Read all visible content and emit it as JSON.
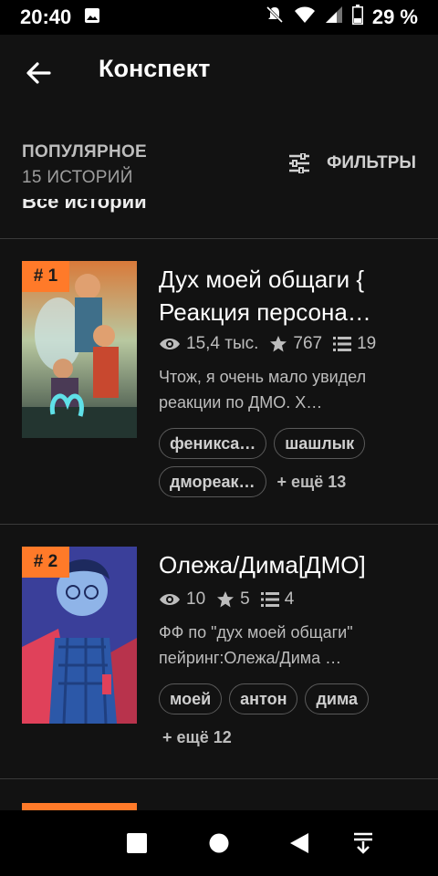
{
  "status": {
    "time": "20:40",
    "battery": "29 %"
  },
  "header": {
    "title": "Конспект"
  },
  "subheader": {
    "title": "ПОПУЛЯРНОЕ",
    "count": "15 ИСТОРИЙ",
    "filter_label": "ФИЛЬТРЫ"
  },
  "cut_heading": "Все истории",
  "stories": [
    {
      "rank": "# 1",
      "title": "Дух моей общаги { Реакция персона…",
      "views": "15,4 тыс.",
      "votes": "767",
      "parts": "19",
      "description": "Чтож, я очень мало увидел реакции по ДМО. Х…",
      "tags": [
        "фениксa…",
        "шашлык",
        "дмореак…"
      ],
      "more": "+ ещё 13"
    },
    {
      "rank": "# 2",
      "title": "Олежа/Дима[ДМО]",
      "views": "10",
      "votes": "5",
      "parts": "4",
      "description": "ФФ по \"дух моей общаги\" пейринг:Олежа/Дима …",
      "tags": [
        "моей",
        "антон",
        "дима"
      ],
      "more": "+ ещё 12"
    }
  ],
  "colors": {
    "accent": "#ff7a29",
    "background": "#121212"
  }
}
